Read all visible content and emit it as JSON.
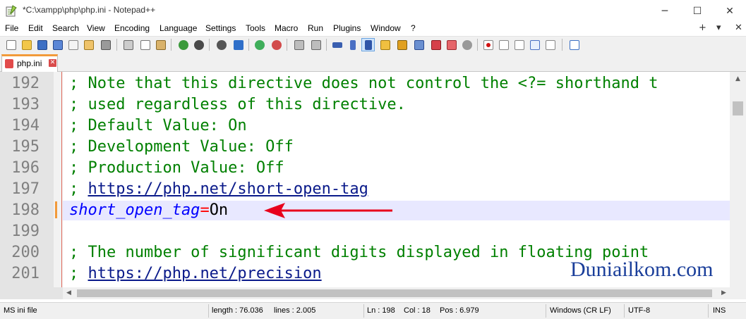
{
  "window": {
    "title": "*C:\\xampp\\php\\php.ini - Notepad++",
    "controls": {
      "minimize": "─",
      "maximize": "☐",
      "close": "✕"
    }
  },
  "menu": {
    "items": [
      "File",
      "Edit",
      "Search",
      "View",
      "Encoding",
      "Language",
      "Settings",
      "Tools",
      "Macro",
      "Run",
      "Plugins",
      "Window",
      "?"
    ],
    "right_add": "+",
    "right_down": "▾",
    "right_close": "✕"
  },
  "toolbar": {
    "icons": [
      "new-file-icon",
      "open-file-icon",
      "save-icon",
      "save-all-icon",
      "close-icon",
      "close-all-icon",
      "print-icon",
      "cut-icon",
      "copy-icon",
      "paste-icon",
      "undo-icon",
      "redo-icon",
      "find-icon",
      "replace-icon",
      "zoom-in-icon",
      "zoom-out-icon",
      "sync-vertical-icon",
      "sync-horizontal-icon",
      "word-wrap-icon",
      "show-all-chars-icon",
      "indent-guide-icon",
      "function-list-icon",
      "doc-map-icon",
      "user-lang-icon",
      "folder-workspace-icon",
      "monitor-icon",
      "record-macro-icon",
      "stop-macro-icon",
      "play-macro-icon",
      "run-macro-multiple-icon",
      "save-macro-icon",
      "panel-icon"
    ]
  },
  "tab": {
    "label": "php.ini",
    "close": "✕"
  },
  "editor": {
    "lines": [
      {
        "no": "192",
        "text": "; Note that this directive does not control the <?= shorthand t"
      },
      {
        "no": "193",
        "text": "; used regardless of this directive."
      },
      {
        "no": "194",
        "text": "; Default Value: On"
      },
      {
        "no": "195",
        "text": "; Development Value: Off"
      },
      {
        "no": "196",
        "text": "; Production Value: Off"
      },
      {
        "no": "197",
        "prefix": "; ",
        "url": "https://php.net/short-open-tag"
      },
      {
        "no": "198",
        "key": "short_open_tag",
        "eq": "=",
        "val": "On"
      },
      {
        "no": "199",
        "text": ""
      },
      {
        "no": "200",
        "text": "; The number of significant digits displayed in floating point"
      },
      {
        "no": "201",
        "prefix": "; ",
        "url": "https://php.net/precision"
      }
    ]
  },
  "scroll": {
    "up": "▲",
    "left": "◀",
    "right": "▶"
  },
  "status": {
    "file_type": "MS ini file",
    "length": "length : 76.036",
    "lines": "lines : 2.005",
    "ln": "Ln : 198",
    "col": "Col : 18",
    "pos": "Pos : 6.979",
    "eol": "Windows (CR LF)",
    "encoding": "UTF-8",
    "mode": "INS"
  },
  "watermark": "Duniailkom.com",
  "colors": {
    "comment": "#008000",
    "url": "#0a1a8a",
    "key": "#0000ff",
    "arrow": "#e8001c",
    "current_line": "#e8e8ff",
    "tab_accent": "#f29a3a"
  }
}
